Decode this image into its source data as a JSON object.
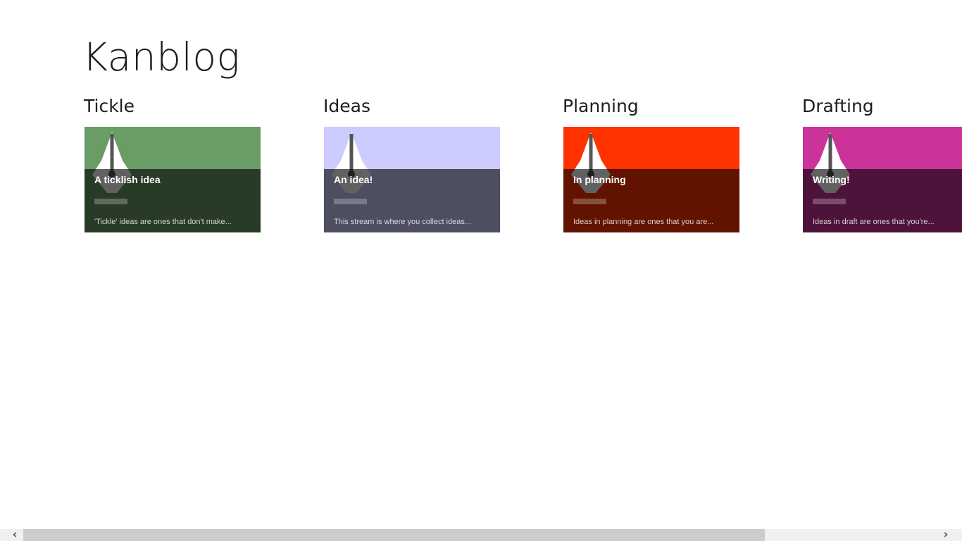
{
  "app": {
    "title": "Kanblog"
  },
  "groups": [
    {
      "header": "Tickle",
      "tile": {
        "title": "A ticklish idea",
        "description": "'Tickle' ideas are ones that don't make...",
        "color": "#6a9c66",
        "icon": "fountain-pen-icon"
      }
    },
    {
      "header": "Ideas",
      "tile": {
        "title": "An idea!",
        "description": "This stream is where you collect ideas...",
        "color": "#ccccff",
        "icon": "fountain-pen-icon"
      }
    },
    {
      "header": "Planning",
      "tile": {
        "title": "In planning",
        "description": "Ideas in planning are ones that you are...",
        "color": "#ff3300",
        "icon": "fountain-pen-icon"
      }
    },
    {
      "header": "Drafting",
      "tile": {
        "title": "Writing!",
        "description": "Ideas in draft are ones that you're...",
        "color": "#cc3399",
        "icon": "fountain-pen-icon"
      }
    }
  ],
  "scrollbar": {
    "left_arrow": "‹",
    "right_arrow": "›"
  }
}
